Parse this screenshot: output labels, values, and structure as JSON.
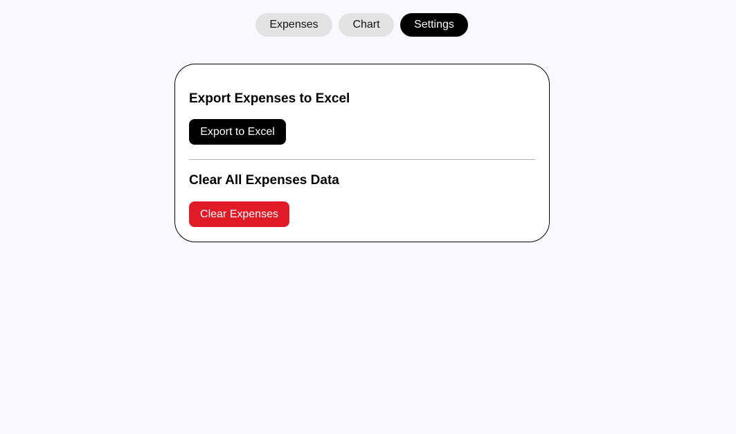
{
  "nav": {
    "tabs": [
      {
        "label": "Expenses",
        "active": false
      },
      {
        "label": "Chart",
        "active": false
      },
      {
        "label": "Settings",
        "active": true
      }
    ]
  },
  "settings": {
    "export": {
      "title": "Export Expenses to Excel",
      "button_label": "Export to Excel"
    },
    "clear": {
      "title": "Clear All Expenses Data",
      "button_label": "Clear Expenses"
    }
  },
  "colors": {
    "background": "#f8f8fe",
    "tab_inactive": "#e3e3e3",
    "tab_active": "#000000",
    "primary_button": "#000000",
    "danger_button": "#e11a27"
  }
}
